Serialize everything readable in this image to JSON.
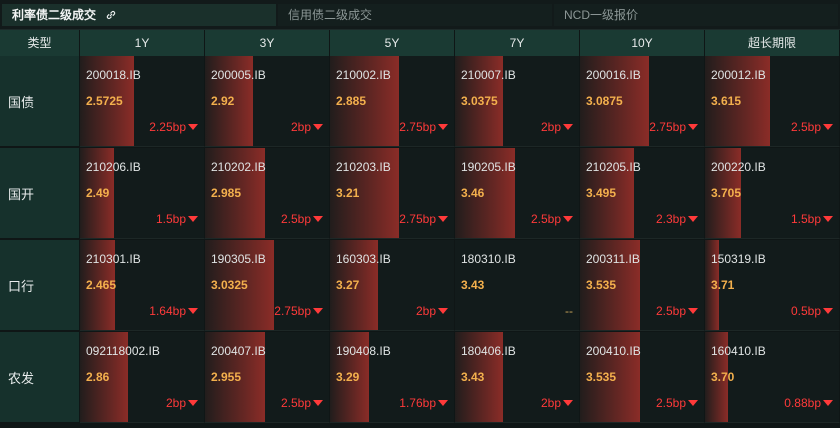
{
  "tabs": [
    {
      "label": "利率债二级成交",
      "active": true
    },
    {
      "label": "信用债二级成交",
      "active": false
    },
    {
      "label": "NCD一级报价",
      "active": false
    }
  ],
  "header": {
    "type_label": "类型",
    "tenors": [
      "1Y",
      "3Y",
      "5Y",
      "7Y",
      "10Y",
      "超长期限"
    ]
  },
  "colors": {
    "accent": "#1a302b",
    "yield": "#f3b04d",
    "down": "#ff3a3a"
  },
  "rows": [
    {
      "label": "国债",
      "cells": [
        {
          "code": "200018.IB",
          "yield": "2.5725",
          "change": "2.25bp",
          "dir": "down",
          "bar": 0.43
        },
        {
          "code": "200005.IB",
          "yield": "2.92",
          "change": "2bp",
          "dir": "down",
          "bar": 0.38
        },
        {
          "code": "210002.IB",
          "yield": "2.885",
          "change": "2.75bp",
          "dir": "down",
          "bar": 0.55
        },
        {
          "code": "210007.IB",
          "yield": "3.0375",
          "change": "2bp",
          "dir": "down",
          "bar": 0.38
        },
        {
          "code": "200016.IB",
          "yield": "3.0875",
          "change": "2.75bp",
          "dir": "down",
          "bar": 0.55
        },
        {
          "code": "200012.IB",
          "yield": "3.615",
          "change": "2.5bp",
          "dir": "down",
          "bar": 0.48
        }
      ]
    },
    {
      "label": "国开",
      "cells": [
        {
          "code": "210206.IB",
          "yield": "2.49",
          "change": "1.5bp",
          "dir": "down",
          "bar": 0.27
        },
        {
          "code": "210202.IB",
          "yield": "2.985",
          "change": "2.5bp",
          "dir": "down",
          "bar": 0.48
        },
        {
          "code": "210203.IB",
          "yield": "3.21",
          "change": "2.75bp",
          "dir": "down",
          "bar": 0.55
        },
        {
          "code": "190205.IB",
          "yield": "3.46",
          "change": "2.5bp",
          "dir": "down",
          "bar": 0.48
        },
        {
          "code": "210205.IB",
          "yield": "3.495",
          "change": "2.3bp",
          "dir": "down",
          "bar": 0.43
        },
        {
          "code": "200220.IB",
          "yield": "3.705",
          "change": "1.5bp",
          "dir": "down",
          "bar": 0.27
        }
      ]
    },
    {
      "label": "口行",
      "cells": [
        {
          "code": "210301.IB",
          "yield": "2.465",
          "change": "1.64bp",
          "dir": "down",
          "bar": 0.28
        },
        {
          "code": "190305.IB",
          "yield": "3.0325",
          "change": "2.75bp",
          "dir": "down",
          "bar": 0.55
        },
        {
          "code": "160303.IB",
          "yield": "3.27",
          "change": "2bp",
          "dir": "down",
          "bar": 0.38
        },
        {
          "code": "180310.IB",
          "yield": "3.43",
          "change": "--",
          "dir": "none",
          "bar": 0.0
        },
        {
          "code": "200311.IB",
          "yield": "3.535",
          "change": "2.5bp",
          "dir": "down",
          "bar": 0.48
        },
        {
          "code": "150319.IB",
          "yield": "3.71",
          "change": "0.5bp",
          "dir": "down",
          "bar": 0.1
        }
      ]
    },
    {
      "label": "农发",
      "cells": [
        {
          "code": "092118002.IB",
          "yield": "2.86",
          "change": "2bp",
          "dir": "down",
          "bar": 0.38
        },
        {
          "code": "200407.IB",
          "yield": "2.955",
          "change": "2.5bp",
          "dir": "down",
          "bar": 0.48
        },
        {
          "code": "190408.IB",
          "yield": "3.29",
          "change": "1.76bp",
          "dir": "down",
          "bar": 0.31
        },
        {
          "code": "180406.IB",
          "yield": "3.43",
          "change": "2bp",
          "dir": "down",
          "bar": 0.38
        },
        {
          "code": "200410.IB",
          "yield": "3.535",
          "change": "2.5bp",
          "dir": "down",
          "bar": 0.48
        },
        {
          "code": "160410.IB",
          "yield": "3.70",
          "change": "0.88bp",
          "dir": "down",
          "bar": 0.17
        }
      ]
    }
  ]
}
